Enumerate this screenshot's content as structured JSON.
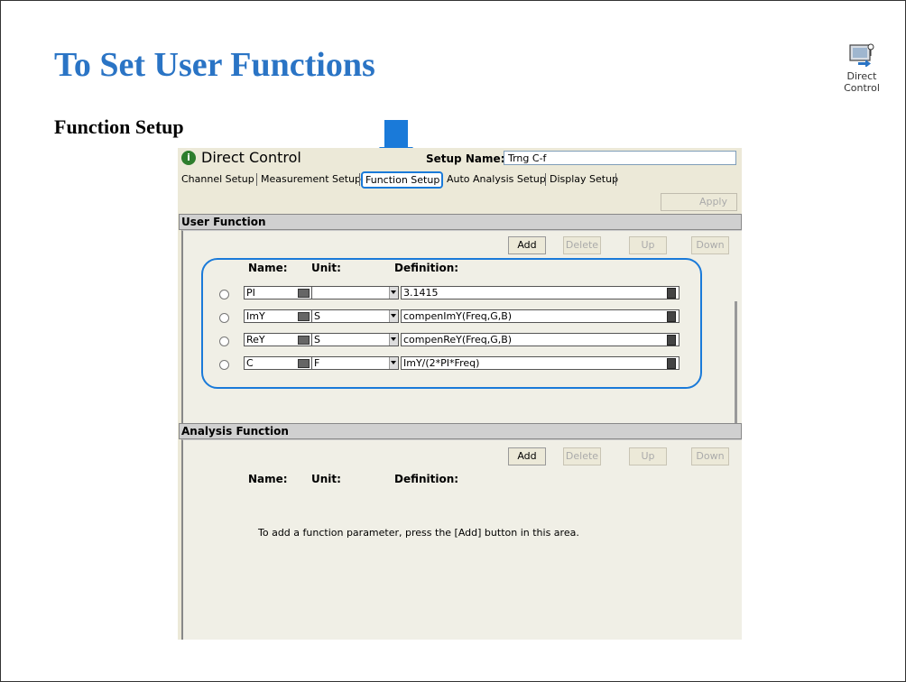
{
  "slide": {
    "title": "To Set User Functions",
    "subtitle": "Function Setup",
    "accent_color": "#2a74c5"
  },
  "desktop_icon": {
    "icon": "direct-control-icon",
    "label_line1": "Direct",
    "label_line2": "Control"
  },
  "window": {
    "app_icon_glyph": "i",
    "title": "Direct Control",
    "setup_name_label": "Setup Name:",
    "setup_name_value": "Trng C-f",
    "tabs": [
      {
        "label": "Channel Setup"
      },
      {
        "label": "Measurement Setup"
      },
      {
        "label": "Function Setup",
        "active": true
      },
      {
        "label": "Auto Analysis Setup"
      },
      {
        "label": "Display Setup"
      }
    ],
    "apply_label": "Apply",
    "user_function": {
      "header": "User Function",
      "buttons": {
        "add": "Add",
        "delete": "Delete",
        "up": "Up",
        "down": "Down"
      },
      "columns": {
        "name": "Name:",
        "unit": "Unit:",
        "definition": "Definition:"
      },
      "rows": [
        {
          "name": "PI",
          "unit": "",
          "definition": "3.1415"
        },
        {
          "name": "ImY",
          "unit": "S",
          "definition": "compenImY(Freq,G,B)"
        },
        {
          "name": "ReY",
          "unit": "S",
          "definition": "compenReY(Freq,G,B)"
        },
        {
          "name": "C",
          "unit": "F",
          "definition": "ImY/(2*PI*Freq)"
        }
      ]
    },
    "analysis_function": {
      "header": "Analysis Function",
      "buttons": {
        "add": "Add",
        "delete": "Delete",
        "up": "Up",
        "down": "Down"
      },
      "columns": {
        "name": "Name:",
        "unit": "Unit:",
        "definition": "Definition:"
      },
      "hint": "To add a function parameter, press the [Add] button in this area."
    }
  },
  "highlight_color": "#1a7ad9"
}
